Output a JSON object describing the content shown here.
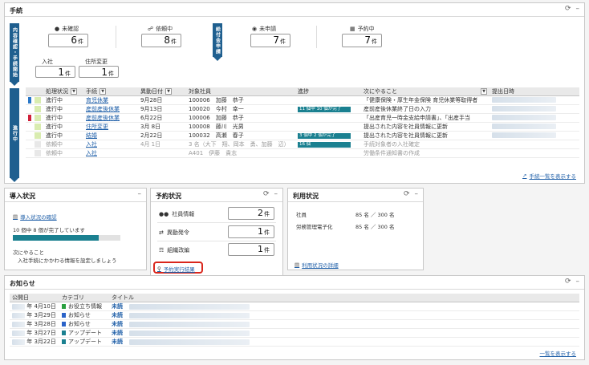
{
  "procedures": {
    "title": "手続",
    "controls": {
      "refresh": "⟳",
      "minimize": "–"
    },
    "content_tab": "内容確認・手続開始",
    "pay_tab": "給付金申請",
    "counts": [
      {
        "label": "未確認",
        "value": "6",
        "unit": "件",
        "icon": "person-icon"
      },
      {
        "label": "依頼中",
        "value": "8",
        "unit": "件",
        "icon": "lock-icon"
      },
      {
        "label": "未申請",
        "value": "7",
        "unit": "件",
        "icon": "globe-icon"
      },
      {
        "label": "予約中",
        "value": "7",
        "unit": "件",
        "icon": "calendar-icon"
      }
    ],
    "counts2": [
      {
        "label": "入社",
        "value": "1",
        "unit": "件"
      },
      {
        "label": "住所変更",
        "value": "1",
        "unit": "件"
      }
    ],
    "progress_tab": "進行中",
    "columns": [
      "処理状況",
      "手続",
      "異動日付",
      "対象社員",
      "進捗",
      "次にやること",
      "提出日時"
    ],
    "rows": [
      {
        "colors": [
          "#2a78c8",
          "#d9ecb0"
        ],
        "status": "進行中",
        "proc": "育児休業",
        "date": "9月28日",
        "emp": "100006　加藤　恭子",
        "progress": "",
        "next": "「健康保険・厚生年金保険 育児休業等取得者",
        "muted": false,
        "proc_link": true
      },
      {
        "colors": [
          "#ffffff",
          "#d9ecb0"
        ],
        "status": "進行中",
        "proc": "産前産後休業",
        "date": "9月13日",
        "emp": "100020　今村　幸一",
        "progress": "11 個中 10 個が完了",
        "next": "産前産後休業終了日の入力",
        "muted": false,
        "proc_link": true
      },
      {
        "colors": [
          "#d0203a",
          "#d9ecb0"
        ],
        "status": "進行中",
        "proc": "産前産後休業",
        "date": "6月22日",
        "emp": "100006　加藤　恭子",
        "progress": "",
        "next": "「出産育児一時金支給申請書」、「出産手当",
        "muted": false,
        "proc_link": true
      },
      {
        "colors": [
          "#ffffff",
          "#d9ecb0"
        ],
        "status": "進行中",
        "proc": "住所変更",
        "date": "3月 8日",
        "emp": "100008　藤川　光男",
        "progress": "",
        "next": "提出された内容を社員情報に更新",
        "muted": false,
        "proc_link": true
      },
      {
        "colors": [
          "#ffffff",
          "#d9ecb0"
        ],
        "status": "進行中",
        "proc": "結婚",
        "date": "2月22日",
        "emp": "100032　高瀬　春子",
        "progress": "3 個中 2 個が完了",
        "next": "提出された内容を社員情報に更新",
        "muted": false,
        "proc_link": true
      },
      {
        "colors": [
          "#ffffff",
          "#e8e8e8"
        ],
        "status": "依頼中",
        "proc": "入社",
        "date": "4月 1日",
        "emp": "3 名（大下　翔、岡本　勇、加藤　辺）",
        "progress": "16 個",
        "next": "手続対象者の入社確定",
        "muted": true,
        "proc_link": true
      },
      {
        "colors": [
          "#ffffff",
          "#e8e8e8"
        ],
        "status": "依頼中",
        "proc": "入社",
        "date": "",
        "emp": "A401　伊藤　貴志",
        "progress": "",
        "next": "労働条件通知書の作成",
        "muted": true,
        "proc_link": true
      }
    ],
    "list_link": "手続一覧を表示する"
  },
  "intro": {
    "title": "導入状況",
    "link": "導入状況の確認",
    "progress_text": "10 個中 8 個が完了しています",
    "progress_fraction": 0.8,
    "next_label": "次にやること",
    "next_text": "入社手続にかかわる情報を設定しましょう"
  },
  "reservation": {
    "title": "予約状況",
    "items": [
      {
        "label": "社員情報",
        "value": "2",
        "unit": "件",
        "icon": "people-icon"
      },
      {
        "label": "異動発令",
        "value": "1",
        "unit": "件",
        "icon": "transfer-icon"
      },
      {
        "label": "組織改編",
        "value": "1",
        "unit": "件",
        "icon": "org-icon"
      }
    ],
    "result_link": "予約実行結果"
  },
  "usage": {
    "title": "利用状況",
    "rows": [
      {
        "label": "社員",
        "value": "85 名 ／ 300 名"
      },
      {
        "label": "労務管理電子化",
        "value": "85 名 ／ 300 名"
      }
    ],
    "link": "利用状況の詳細"
  },
  "news": {
    "title": "お知らせ",
    "columns": [
      "公開日",
      "カテゴリ",
      "タイトル"
    ],
    "rows": [
      {
        "date": "年  4月10日",
        "color": "#2aa040",
        "category": "お役立ち情報",
        "read": "未読"
      },
      {
        "date": "年  3月29日",
        "color": "#2a62c8",
        "category": "お知らせ",
        "read": "未読"
      },
      {
        "date": "年  3月28日",
        "color": "#2a62c8",
        "category": "お知らせ",
        "read": "未読"
      },
      {
        "date": "年  3月27日",
        "color": "#1a8090",
        "category": "アップデート",
        "read": "未読"
      },
      {
        "date": "年  3月22日",
        "color": "#1a8090",
        "category": "アップデート",
        "read": "未読"
      }
    ],
    "link": "一覧を表示する"
  }
}
